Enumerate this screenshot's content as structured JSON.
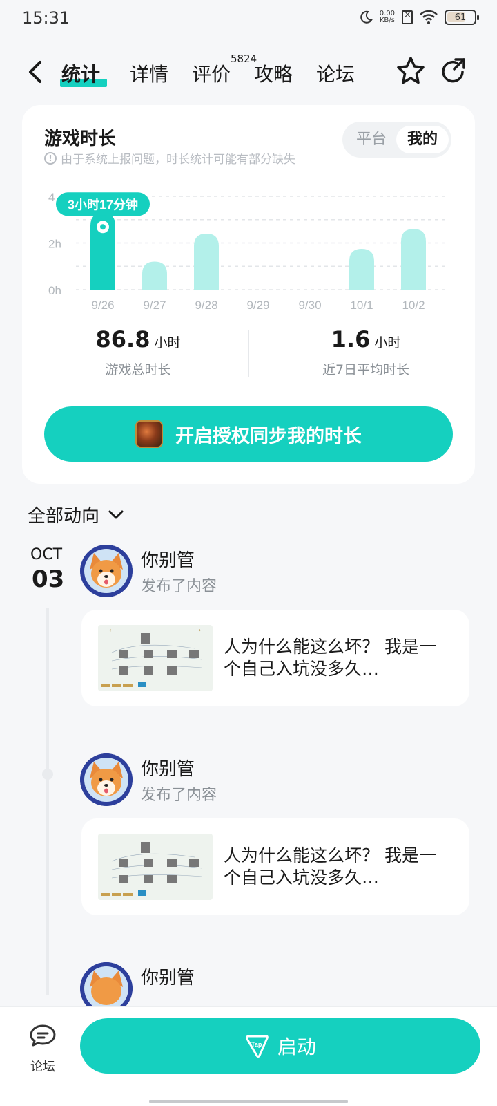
{
  "status_bar": {
    "time": "15:31",
    "net_speed_value": "0.00",
    "net_speed_unit": "KB/s",
    "battery": "61"
  },
  "nav": {
    "tabs": [
      {
        "label": "统计",
        "active": true
      },
      {
        "label": "详情",
        "active": false
      },
      {
        "label": "评价",
        "active": false
      },
      {
        "label": "攻略",
        "active": false
      },
      {
        "label": "论坛",
        "active": false
      }
    ],
    "review_count": "5824"
  },
  "playtime_card": {
    "title": "游戏时长",
    "note": "由于系统上报问题，时长统计可能有部分缺失",
    "toggle": {
      "platform": "平台",
      "mine": "我的",
      "selected": "mine"
    },
    "total_value": "86.8",
    "total_unit": "小时",
    "total_label": "游戏总时长",
    "avg_value": "1.6",
    "avg_unit": "小时",
    "avg_label": "近7日平均时长",
    "sync_button": "开启授权同步我的时长"
  },
  "chart_data": {
    "type": "bar",
    "categories": [
      "9/26",
      "9/27",
      "9/28",
      "9/29",
      "9/30",
      "10/1",
      "10/2"
    ],
    "values": [
      3.28,
      1.2,
      2.4,
      0,
      0,
      1.75,
      2.6
    ],
    "y_ticks": [
      "0h",
      "2h",
      "4"
    ],
    "ylim": [
      0,
      4
    ],
    "highlight_index": 0,
    "tooltip": "3小时17分钟",
    "colors": {
      "highlight": "#15d0bf",
      "normal": "#b3f0ea"
    }
  },
  "feed": {
    "filter_label": "全部动向",
    "date_month": "OCT",
    "date_day": "03",
    "posts": [
      {
        "user": "你别管",
        "action": "发布了内容",
        "text": "人为什么能这么坏？ 我是一个自己入坑没多久…"
      },
      {
        "user": "你别管",
        "action": "发布了内容",
        "text": "人为什么能这么坏？ 我是一个自己入坑没多久…"
      },
      {
        "user": "你别管"
      }
    ]
  },
  "bottom_bar": {
    "forum_label": "论坛",
    "launch_label": "启动",
    "tap_icon_text": "Tap"
  }
}
